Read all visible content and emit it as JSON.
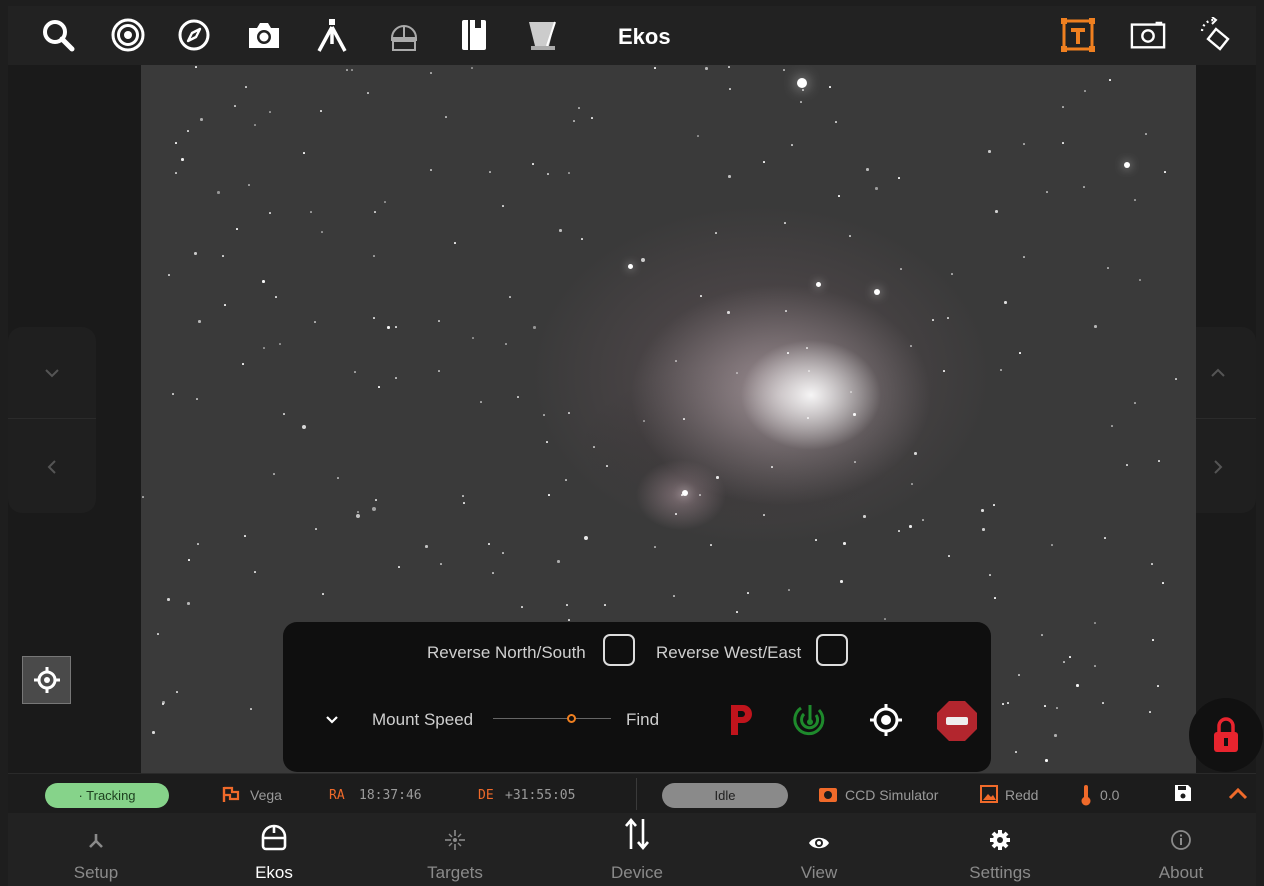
{
  "toolbar": {
    "title": "Ekos",
    "icons": [
      "search-icon",
      "target-rings-icon",
      "compass-icon",
      "camera-icon",
      "telescope-tripod-icon",
      "observatory-dome-icon",
      "notebook-icon",
      "filter-wheel-icon",
      "text-label-icon",
      "frame-icon",
      "rotate-icon"
    ],
    "accent": "#f08020"
  },
  "mount": {
    "reverse_ns_label": "Reverse North/South",
    "reverse_we_label": "Reverse West/East",
    "reverse_ns_checked": false,
    "reverse_we_checked": false,
    "speed_label": "Mount Speed",
    "speed_value_label": "Find",
    "controls": [
      "park-icon",
      "tracking-icon",
      "center-target-icon",
      "stop-icon"
    ]
  },
  "status": {
    "tracking": "· Tracking",
    "target_name": "Vega",
    "ra_label": "RA",
    "ra_value": "18:37:46",
    "de_label": "DE",
    "de_value": "+31:55:05",
    "state": "Idle",
    "camera": "CCD Simulator",
    "filter": "Redd",
    "temperature": "0.0",
    "colors": {
      "tracking": "#86d38a",
      "accent": "#f06a2a"
    }
  },
  "nav": {
    "items": [
      {
        "label": "Setup",
        "icon": "setup-icon"
      },
      {
        "label": "Ekos",
        "icon": "ekos-dome-icon"
      },
      {
        "label": "Targets",
        "icon": "targets-icon"
      },
      {
        "label": "Device",
        "icon": "device-arrows-icon"
      },
      {
        "label": "View",
        "icon": "eye-icon"
      },
      {
        "label": "Settings",
        "icon": "gear-icon"
      },
      {
        "label": "About",
        "icon": "info-icon"
      }
    ],
    "active": "Ekos"
  }
}
